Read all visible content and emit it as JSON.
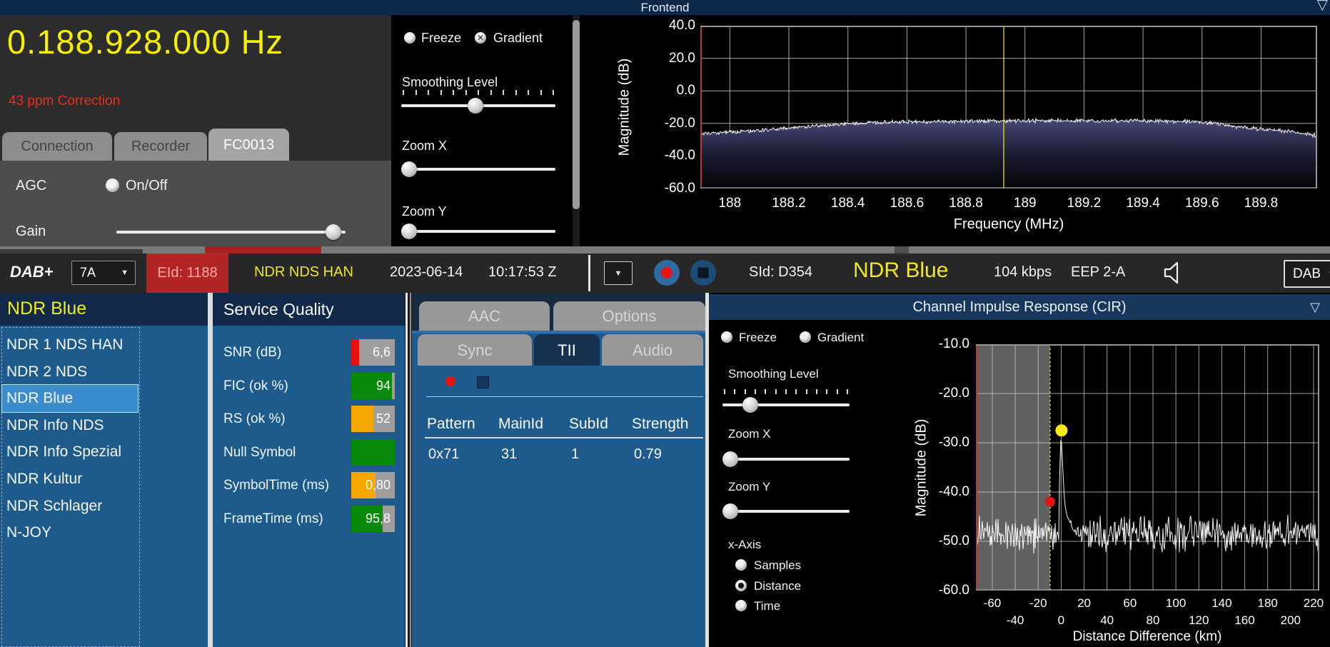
{
  "titlebar": {
    "title": "Frontend",
    "collapse_icon": "▽"
  },
  "frontend": {
    "frequency_value": "0.188.928.000",
    "frequency_unit": "Hz",
    "correction": "43 ppm Correction",
    "tabs": [
      {
        "label": "Connection",
        "active": false
      },
      {
        "label": "Recorder",
        "active": false
      },
      {
        "label": "FC0013",
        "active": true
      }
    ],
    "agc": {
      "label": "AGC",
      "option": "On/Off",
      "checked": false
    },
    "gain": {
      "label": "Gain",
      "position": 0.98
    },
    "controls": {
      "freeze": {
        "label": "Freeze",
        "checked": false
      },
      "gradient": {
        "label": "Gradient",
        "checked": true
      },
      "smoothing": {
        "label": "Smoothing Level",
        "position": 0.48
      },
      "zoom_x": {
        "label": "Zoom X",
        "position": 0
      },
      "zoom_y": {
        "label": "Zoom Y",
        "position": 0
      }
    }
  },
  "statusbar": {
    "mode": "DAB+",
    "channel": "7A",
    "eid": "EId: 1188",
    "ensemble": "NDR NDS HAN",
    "date": "2023-06-14",
    "time": "10:17:53 Z",
    "sid": "SId: D354",
    "service": "NDR Blue",
    "bitrate": "104 kbps",
    "protection": "EEP 2-A",
    "speaker_icon": "speaker-icon",
    "band": "DAB",
    "caret_icon": "▼"
  },
  "services": {
    "header": "NDR Blue",
    "selected": "NDR Blue",
    "items": [
      "NDR 1 NDS HAN",
      "NDR 2 NDS",
      "NDR Blue",
      "NDR Info NDS",
      "NDR Info Spezial",
      "NDR Kultur",
      "NDR Schlager",
      "N-JOY"
    ]
  },
  "service_quality": {
    "header": "Service Quality",
    "track_color": "#9e9e9e",
    "rows": [
      {
        "label": "SNR (dB)",
        "value": "6,6",
        "fill": 0.18,
        "color": "#e81111"
      },
      {
        "label": "FIC (ok %)",
        "value": "94",
        "fill": 0.94,
        "color": "#0a8a0a"
      },
      {
        "label": "RS (ok %)",
        "value": "52",
        "fill": 0.51,
        "color": "#f6a800"
      },
      {
        "label": "Null Symbol",
        "value": "",
        "fill": 1.0,
        "color": "#0a8a0a"
      },
      {
        "label": "SymbolTime (ms)",
        "value": "0,80",
        "fill": 0.56,
        "color": "#f6a800"
      },
      {
        "label": "FrameTime (ms)",
        "value": "95,8",
        "fill": 0.72,
        "color": "#0a8a0a"
      }
    ]
  },
  "decoder": {
    "tabs_row1": [
      {
        "label": "AAC",
        "active": false
      },
      {
        "label": "Options",
        "active": false
      }
    ],
    "tabs_row2": [
      {
        "label": "Sync",
        "active": false
      },
      {
        "label": "TII",
        "active": true
      },
      {
        "label": "Audio",
        "active": false
      }
    ],
    "tii": {
      "columns": [
        "Pattern",
        "MainId",
        "SubId",
        "Strength"
      ],
      "rows": [
        [
          "0x71",
          "31",
          "1",
          "0.79"
        ]
      ]
    }
  },
  "cir": {
    "title": "Channel Impulse Response (CIR)",
    "collapse_icon": "▽",
    "controls": {
      "freeze": {
        "label": "Freeze",
        "checked": false
      },
      "gradient": {
        "label": "Gradient",
        "checked": false
      },
      "smoothing": {
        "label": "Smoothing Level",
        "position": 0.18
      },
      "zoom_x": {
        "label": "Zoom X",
        "position": 0
      },
      "zoom_y": {
        "label": "Zoom Y",
        "position": 0
      },
      "x_axis": {
        "label": "x-Axis",
        "options": [
          "Samples",
          "Distance",
          "Time"
        ],
        "selected": "Distance"
      }
    }
  },
  "chart_data": [
    {
      "id": "frontend-spectrum",
      "type": "line",
      "title": "Frontend",
      "xlabel": "Frequency (MHz)",
      "ylabel": "Magnitude (dB)",
      "xlim": [
        187.9,
        189.99
      ],
      "ylim": [
        -60,
        40
      ],
      "xticks": [
        188,
        188.2,
        188.4,
        188.6,
        188.8,
        189,
        189.2,
        189.4,
        189.6,
        189.8
      ],
      "yticks": [
        40,
        20,
        0,
        -20,
        -40,
        -60
      ],
      "grid": true,
      "tuned_frequency_mhz": 188.928,
      "marker_line_color": "#f5f500",
      "trace_color": "#ffffff",
      "noise_db": 1.4,
      "envelope": [
        [
          187.9,
          -26.5
        ],
        [
          188.0,
          -25.3
        ],
        [
          188.1,
          -24.3
        ],
        [
          188.2,
          -22.8
        ],
        [
          188.3,
          -21.3
        ],
        [
          188.45,
          -19.8
        ],
        [
          188.6,
          -19.0
        ],
        [
          188.8,
          -18.6
        ],
        [
          189.1,
          -18.3
        ],
        [
          189.4,
          -18.4
        ],
        [
          189.55,
          -18.8
        ],
        [
          189.65,
          -20.0
        ],
        [
          189.72,
          -22.0
        ],
        [
          189.8,
          -23.5
        ],
        [
          189.9,
          -25.0
        ],
        [
          189.99,
          -27.5
        ]
      ],
      "fill_top_color": "#4a4a7c",
      "fill_bottom_color": "#050508"
    },
    {
      "id": "cir",
      "type": "line",
      "title": "Channel Impulse Response (CIR)",
      "xlabel": "Distance Difference (km)",
      "ylabel": "Magnitude (dB)",
      "xlim": [
        -74.3,
        225
      ],
      "ylim": [
        -60,
        -10
      ],
      "xticks_row1": [
        -60,
        -20,
        20,
        60,
        100,
        140,
        180,
        220
      ],
      "xticks_row2": [
        -40,
        0,
        40,
        80,
        120,
        160,
        200
      ],
      "yticks": [
        -10,
        -20,
        -30,
        -40,
        -50,
        -60
      ],
      "grid": true,
      "shaded_region_end_km": -9.6,
      "window_line_km": -9.6,
      "baseline_db": -48.5,
      "noise_db": 4.2,
      "peak_envelope": [
        [
          -74.3,
          -120
        ],
        [
          -2.6,
          -60
        ],
        [
          -1.5,
          -39
        ],
        [
          -0.7,
          -31.5
        ],
        [
          0,
          -28.3
        ],
        [
          0.9,
          -32.5
        ],
        [
          2,
          -38
        ],
        [
          3.2,
          -42.5
        ],
        [
          5,
          -44.8
        ],
        [
          7.5,
          -46
        ],
        [
          10,
          -47.5
        ],
        [
          225,
          -120
        ]
      ],
      "markers": [
        {
          "x": -9.6,
          "y": -42,
          "color": "#e01414",
          "name": "window-marker"
        },
        {
          "x": 0.3,
          "y": -27.5,
          "color": "#f4ea16",
          "name": "main-peak-marker"
        }
      ],
      "trace_color": "#ffffff"
    }
  ]
}
